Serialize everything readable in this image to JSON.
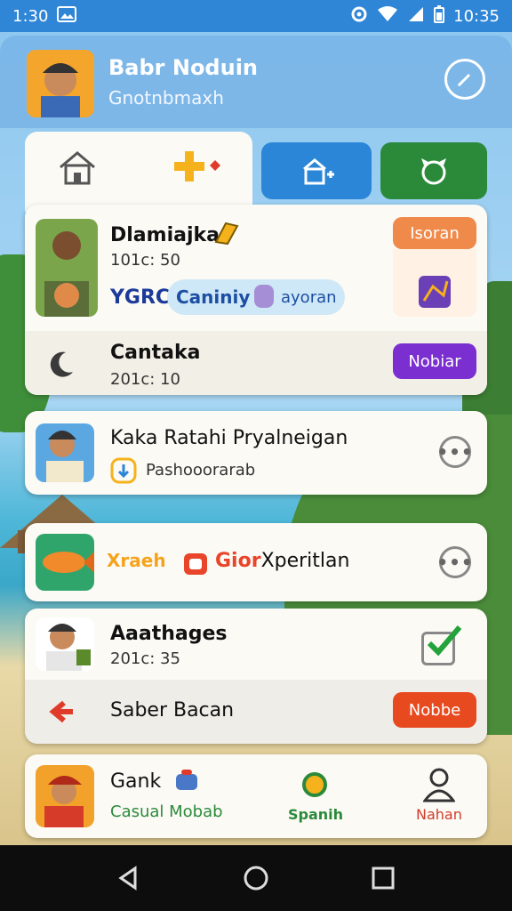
{
  "status_bar": {
    "time_left": "1:30",
    "time_right": "10:35"
  },
  "header": {
    "name": "Babr Noduin",
    "subtitle": "Gnotnbmaxh"
  },
  "cards": {
    "c1": {
      "title": "Dlamiajka",
      "meta": "101c: 50",
      "tag_text": "YGRC",
      "chip_label": "Caniniy",
      "chip_extra": "ayoran",
      "side_button": "Isoran"
    },
    "c1b": {
      "title": "Cantaka",
      "meta": "201c: 10",
      "button": "Nobiar"
    },
    "c2": {
      "title": "Kaka Ratahi Pryalneigan",
      "sub": "Pashooorarab"
    },
    "c3": {
      "label_a": "Xraeh",
      "label_b_red": "Gior",
      "label_b_dark": "Xperitlan"
    },
    "c4": {
      "title": "Aaathages",
      "meta": "201c: 35"
    },
    "c4b": {
      "title": "Saber Bacan",
      "button": "Nobbe"
    },
    "c5": {
      "title": "Gank",
      "sub": "Casual Mobab",
      "nav_mid": "Spanih",
      "nav_right": "Nahan"
    }
  },
  "colors": {
    "blue": "#2b86d8",
    "green": "#2b8a3a",
    "orange": "#f08a4b",
    "purple": "#7b2fd0",
    "red": "#e84a1f"
  }
}
